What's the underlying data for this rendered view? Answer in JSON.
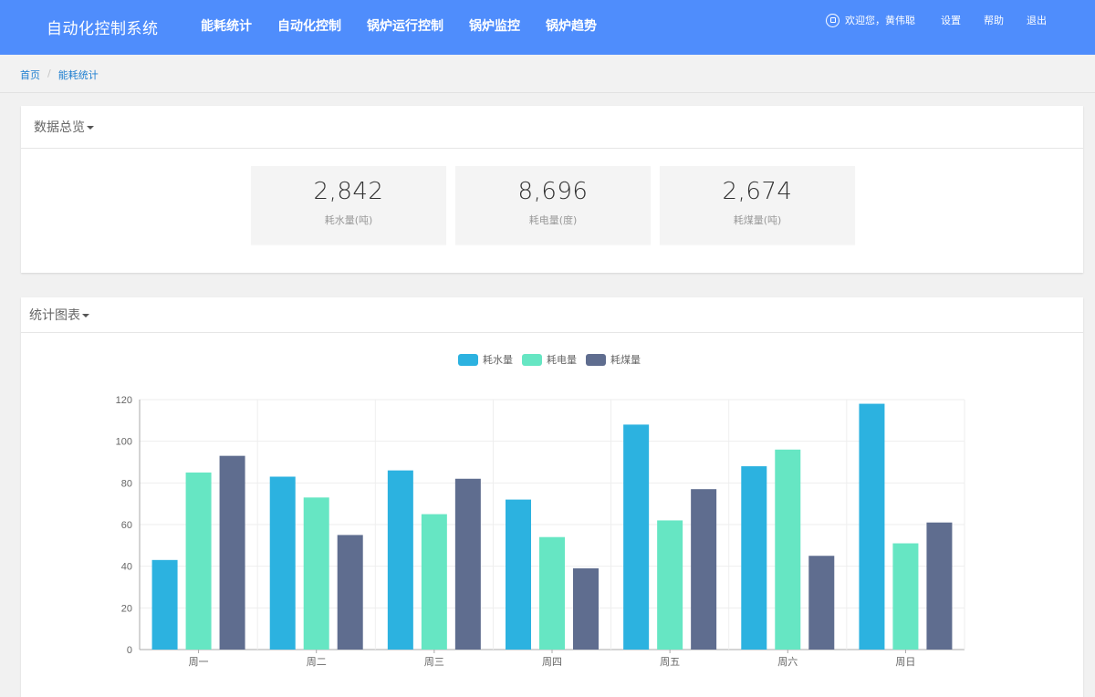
{
  "header": {
    "brand": "自动化控制系统",
    "nav": [
      "能耗统计",
      "自动化控制",
      "锅炉运行控制",
      "锅炉监控",
      "锅炉趋势"
    ],
    "welcome": "欢迎您，黄伟聪",
    "links": [
      "设置",
      "帮助",
      "退出"
    ]
  },
  "breadcrumb": {
    "home": "首页",
    "separator": "/",
    "current": "能耗统计"
  },
  "overview": {
    "title": "数据总览",
    "stats": [
      {
        "value": "2,842",
        "label": "耗水量(吨)"
      },
      {
        "value": "8,696",
        "label": "耗电量(度)"
      },
      {
        "value": "2,674",
        "label": "耗煤量(吨)"
      }
    ]
  },
  "chart_panel": {
    "title": "统计图表"
  },
  "chart_data": {
    "type": "bar",
    "categories": [
      "周一",
      "周二",
      "周三",
      "周四",
      "周五",
      "周六",
      "周日"
    ],
    "series": [
      {
        "name": "耗水量",
        "color": "#2cb2e0",
        "values": [
          43,
          83,
          86,
          72,
          108,
          88,
          118
        ]
      },
      {
        "name": "耗电量",
        "color": "#66e6c3",
        "values": [
          85,
          73,
          65,
          54,
          62,
          96,
          51
        ]
      },
      {
        "name": "耗煤量",
        "color": "#5f6d8f",
        "values": [
          93,
          55,
          82,
          39,
          77,
          45,
          61
        ]
      }
    ],
    "yticks": [
      "0",
      "20",
      "40",
      "60",
      "80",
      "100",
      "120"
    ],
    "ylim": [
      0,
      120
    ],
    "legend": "top-center",
    "grid": true
  }
}
